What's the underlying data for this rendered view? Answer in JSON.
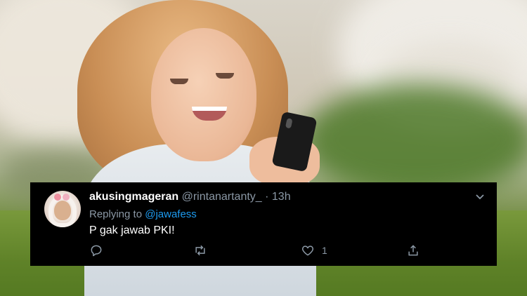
{
  "tweet": {
    "display_name": "akusingmageran",
    "handle": "@rintanartanty_",
    "separator": " · ",
    "time": "13h",
    "reply_label": "Replying to ",
    "reply_to": "@jawafess",
    "text": "P gak jawab PKI!",
    "like_count": "1"
  },
  "icons": {
    "reply": "reply-icon",
    "retweet": "retweet-icon",
    "like": "heart-icon",
    "share": "share-icon",
    "menu": "chevron-down-icon"
  },
  "colors": {
    "card_bg": "#000000",
    "muted": "#8b98a5",
    "link": "#1d9bf0"
  }
}
